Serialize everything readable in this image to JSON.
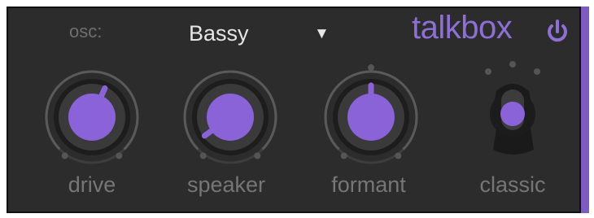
{
  "header": {
    "osc_label": "osc:",
    "preset_value": "Bassy",
    "preset_arrow": "▼",
    "title": "talkbox",
    "power_icon": "power-icon"
  },
  "controls": {
    "knobs": [
      {
        "label": "drive",
        "value": 0.58
      },
      {
        "label": "speaker",
        "value": 0.08
      },
      {
        "label": "formant",
        "value": 0.5
      }
    ],
    "switch": {
      "label": "classic"
    }
  },
  "colors": {
    "accent": "#8e6fd6",
    "knob_face": "#8a63d8",
    "panel": "#2c2c2c",
    "text_muted": "#767676",
    "text_light": "#e6e6e6"
  }
}
